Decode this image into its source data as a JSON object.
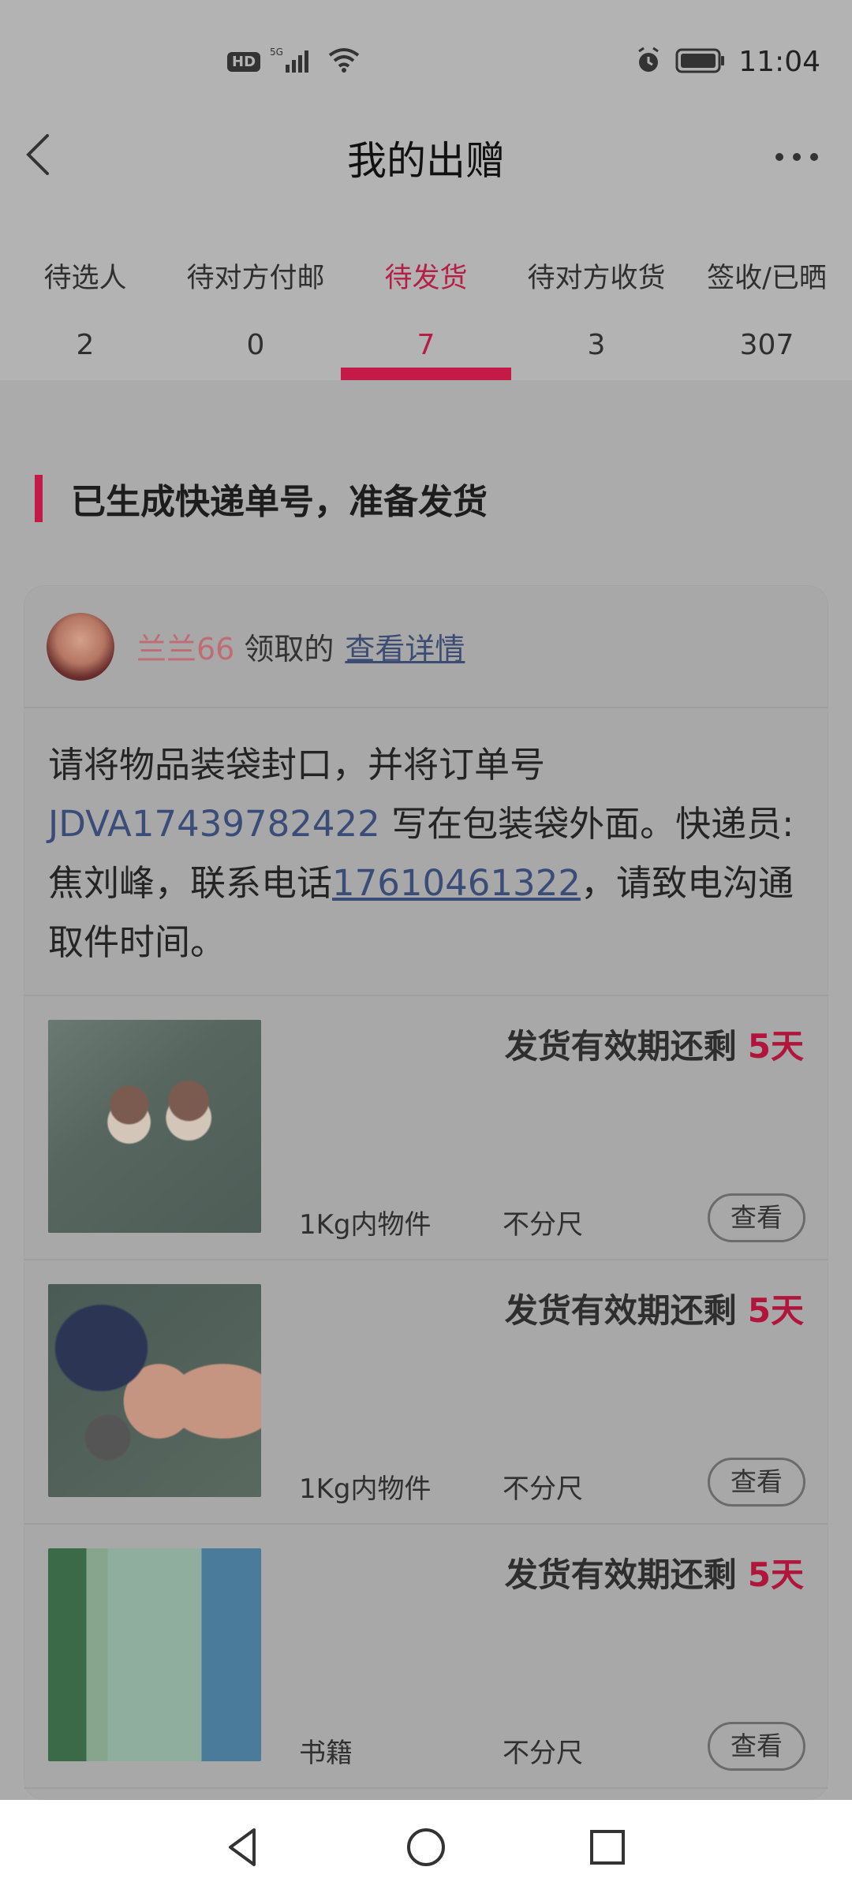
{
  "status_bar": {
    "hd_label": "HD",
    "net_label": "5G",
    "time": "11:04",
    "icons": [
      "hd-icon",
      "signal-icon",
      "wifi-icon",
      "alarm-icon",
      "battery-icon"
    ]
  },
  "header": {
    "title": "我的出赠",
    "icons": [
      "back-icon",
      "more-icon"
    ]
  },
  "tabs": [
    {
      "label": "待选人",
      "count": "2",
      "active": false
    },
    {
      "label": "待对方付邮",
      "count": "0",
      "active": false
    },
    {
      "label": "待发货",
      "count": "7",
      "active": true
    },
    {
      "label": "待对方收货",
      "count": "3",
      "active": false
    },
    {
      "label": "签收/已晒",
      "count": "307",
      "active": false
    }
  ],
  "colors": {
    "accent": "#c31a47",
    "link": "#3a4d78",
    "username": "#c06c74"
  },
  "section": {
    "title": "已生成快递单号，准备发货"
  },
  "card": {
    "user_name": "兰兰66",
    "claim_text": "领取的",
    "detail_link": "查看详情",
    "instruction": {
      "part1": "请将物品装袋封口，并将订单号 ",
      "order_no": "JDVA17439782422",
      "part2": " 写在包装袋外面。快递员:焦刘峰，联系电话",
      "phone": "17610461322",
      "part3": "，请致电沟通取件时间。"
    },
    "items": [
      {
        "deadline_label": "发货有效期还剩",
        "days": "5天",
        "category": "1Kg内物件",
        "size": "不分尺",
        "button": "查看"
      },
      {
        "deadline_label": "发货有效期还剩",
        "days": "5天",
        "category": "1Kg内物件",
        "size": "不分尺",
        "button": "查看"
      },
      {
        "deadline_label": "发货有效期还剩",
        "days": "5天",
        "category": "书籍",
        "size": "不分尺",
        "button": "查看"
      }
    ]
  },
  "nav": {
    "icons": [
      "nav-back-icon",
      "nav-home-icon",
      "nav-recents-icon"
    ]
  }
}
